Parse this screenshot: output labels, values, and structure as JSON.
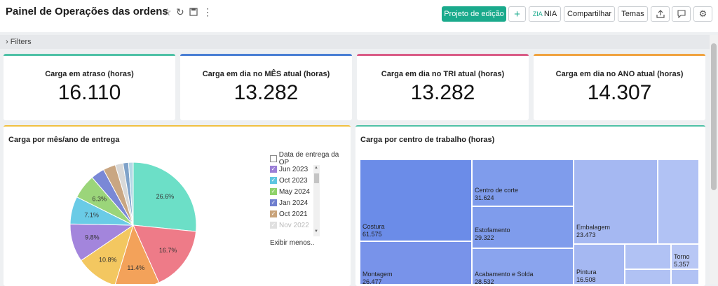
{
  "header": {
    "title": "Painel de Operações das ordens",
    "edit_button": "Projeto de edição",
    "add_button": "+",
    "nia_button": "NIA",
    "share_button": "Compartilhar",
    "themes_button": "Temas"
  },
  "filters": {
    "label": "Filters"
  },
  "kpis": [
    {
      "label": "Carga em atraso (horas)",
      "value": "16.110",
      "color": "#4fc1a6"
    },
    {
      "label": "Carga em dia no MÊS atual (horas)",
      "value": "13.282",
      "color": "#4a7fd4"
    },
    {
      "label": "Carga em dia no TRI atual (horas)",
      "value": "13.282",
      "color": "#d95c86"
    },
    {
      "label": "Carga em dia no ANO atual (horas)",
      "value": "14.307",
      "color": "#f0a340"
    }
  ],
  "left_panel": {
    "title": "Carga por mês/ano de entrega",
    "border_color": "#f0c040",
    "legend_header": "Data de entrega da OP",
    "legend_items": [
      {
        "label": "Jun 2023",
        "color": "#9b7fd6"
      },
      {
        "label": "Oct 2023",
        "color": "#5fc6e0"
      },
      {
        "label": "May 2024",
        "color": "#8fd26a"
      },
      {
        "label": "Jan 2024",
        "color": "#6f7fcf"
      },
      {
        "label": "Oct 2021",
        "color": "#c9a37a"
      },
      {
        "label": "Nov 2022",
        "color": "#cccccc"
      }
    ],
    "legend_more": "Exibir menos.."
  },
  "right_panel": {
    "title": "Carga por centro de trabalho (horas)",
    "border_color": "#4fc1a6",
    "tiles": [
      {
        "name": "Costura",
        "value": "61.575",
        "color": "#6b8ce8"
      },
      {
        "name": "Centro de corte",
        "value": "31.624",
        "color": "#7f9cec"
      },
      {
        "name": "Estofamento",
        "value": "29.322",
        "color": "#7f9cec"
      },
      {
        "name": "Montagem",
        "value": "26.477",
        "color": "#7893ea"
      },
      {
        "name": "Acabamento e Solda",
        "value": "28.532",
        "color": "#8aa4ee"
      },
      {
        "name": "Embalagem",
        "value": "23.473",
        "color": "#a5b8f2"
      },
      {
        "name": "Pintura",
        "value": "16.508",
        "color": "#a5b8f2"
      },
      {
        "name": "Torno",
        "value": "5.357",
        "color": "#b8c7f5"
      }
    ]
  },
  "chart_data": {
    "type": "pie",
    "title": "Carga por mês/ano de entrega",
    "slices": [
      {
        "value": 26.6,
        "label": "26.6%",
        "color": "#6cdfc7"
      },
      {
        "value": 16.7,
        "label": "16.7%",
        "color": "#ee7b88"
      },
      {
        "value": 11.4,
        "label": "11.4%",
        "color": "#f3a25a"
      },
      {
        "value": 10.8,
        "label": "10.8%",
        "color": "#f3c760"
      },
      {
        "value": 9.8,
        "label": "9.8%",
        "color": "#a385dc"
      },
      {
        "value": 7.1,
        "label": "7.1%",
        "color": "#6acbe6"
      },
      {
        "value": 6.3,
        "label": "6.3%",
        "color": "#9bd57a"
      },
      {
        "value": 3.5,
        "label": "",
        "color": "#7a88d6"
      },
      {
        "value": 3.2,
        "label": "",
        "color": "#c9a682"
      },
      {
        "value": 2.0,
        "label": "",
        "color": "#d8d8d8"
      },
      {
        "value": 1.4,
        "label": "",
        "color": "#7fa2c9"
      },
      {
        "value": 1.2,
        "label": "",
        "color": "#b4d9e6"
      }
    ]
  }
}
